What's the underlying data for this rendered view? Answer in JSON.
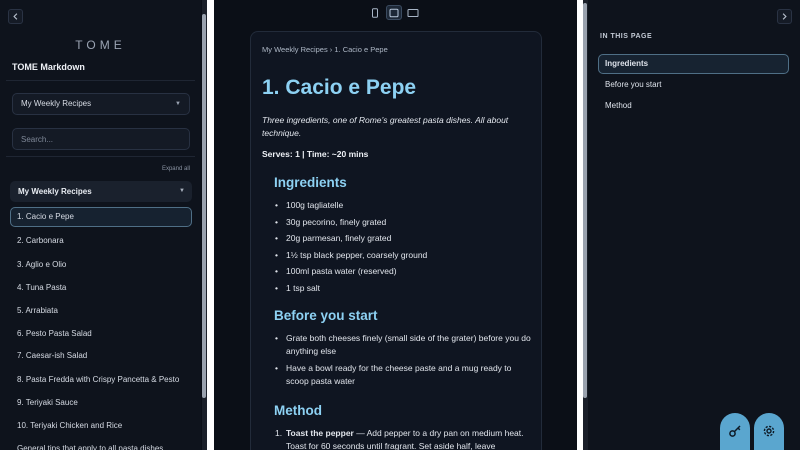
{
  "sidebar": {
    "collapse_icon": "chevron-left-icon",
    "brand": "TOME",
    "site_title": "TOME Markdown",
    "collection_select": "My Weekly Recipes",
    "search_placeholder": "Search...",
    "expand_all": "Expand all",
    "group_label": "My Weekly Recipes",
    "items": [
      {
        "label": "1. Cacio e Pepe",
        "active": true
      },
      {
        "label": "2. Carbonara"
      },
      {
        "label": "3. Aglio e Olio"
      },
      {
        "label": "4. Tuna Pasta"
      },
      {
        "label": "5. Arrabiata"
      },
      {
        "label": "6. Pesto Pasta Salad"
      },
      {
        "label": "7. Caesar-ish Salad"
      },
      {
        "label": "8. Pasta Fredda with Crispy Pancetta & Pesto"
      },
      {
        "label": "9. Teriyaki Sauce"
      },
      {
        "label": "10. Teriyaki Chicken and Rice"
      },
      {
        "label": "General tips that apply to all pasta dishes"
      }
    ]
  },
  "view_toggles": {
    "icons": [
      "phone-icon",
      "tablet-icon",
      "desktop-icon"
    ],
    "active_index": 1
  },
  "content": {
    "breadcrumb": "My Weekly Recipes › 1. Cacio e Pepe",
    "title": "1. Cacio e Pepe",
    "intro": "Three ingredients, one of Rome’s greatest pasta dishes. All about technique.",
    "serves": "Serves: 1 | Time: ~20 mins",
    "ingredients_heading": "Ingredients",
    "ingredients": [
      "100g tagliatelle",
      "30g pecorino, finely grated",
      "20g parmesan, finely grated",
      "1½ tsp black pepper, coarsely ground",
      "100ml pasta water (reserved)",
      "1 tsp salt"
    ],
    "before_heading": "Before you start",
    "before": [
      "Grate both cheeses finely (small side of the grater) before you do anything else",
      "Have a bowl ready for the cheese paste and a mug ready to scoop pasta water"
    ],
    "method_heading": "Method",
    "method": [
      {
        "num": "1.",
        "bold": "Toast the pepper",
        "text": " — Add pepper to a dry pan on medium heat. Toast for 60 seconds until fragrant. Set aside half, leave"
      }
    ]
  },
  "toc": {
    "collapse_icon": "chevron-right-icon",
    "heading": "IN THIS PAGE",
    "items": [
      {
        "label": "Ingredients",
        "active": true
      },
      {
        "label": "Before you start"
      },
      {
        "label": "Method"
      }
    ]
  },
  "fabs": [
    "key-icon",
    "gear-icon"
  ],
  "colors": {
    "accent": "#8dd1f3",
    "fab": "#5aa6cf",
    "active_border": "#4f6f86",
    "background": "#0b0f17"
  }
}
